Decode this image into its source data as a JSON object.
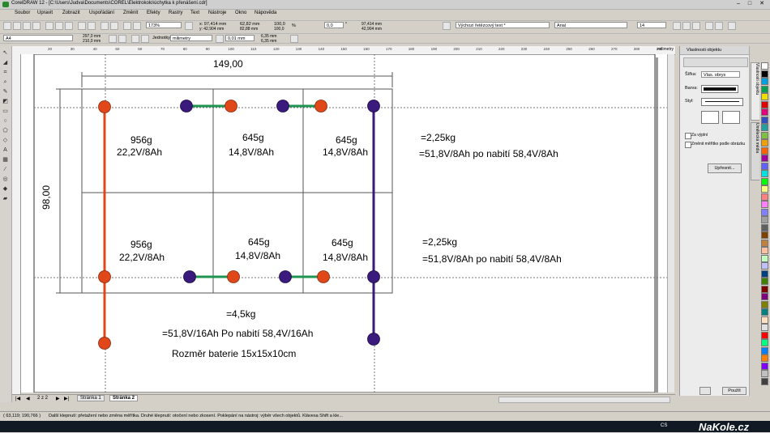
{
  "window": {
    "title": "CorelDRAW 12 - [C:\\Users\\Judva\\Documents\\COREL\\Elektrokolo\\úchytka k přenášení.cdr]"
  },
  "menu": [
    "Soubor",
    "Upravit",
    "Zobrazit",
    "Uspořádání",
    "Změnit",
    "Efekty",
    "Rastry",
    "Text",
    "Nástroje",
    "Okno",
    "Nápověda"
  ],
  "toolbar": {
    "zoom": "173%",
    "pos_x": "x: 97,414 mm",
    "pos_y": "y: 42,904 mm",
    "size_w": "62,82 mm",
    "size_h": "82,88 mm",
    "scale_w": "100,0",
    "scale_h": "100,0",
    "percent": "%",
    "angle": "0,0",
    "angle_unit": "°",
    "x2": "97,414 mm",
    "y2": "42,904 mm",
    "text_style": "Výchozí řetězcový text *",
    "font": "Arial",
    "font_size": "14"
  },
  "propbar": {
    "paper": "A4",
    "page_w": "297,0 mm",
    "page_h": "210,0 mm",
    "units_label": "Jednotky:",
    "units": "milimetry",
    "nudge": "0,01 mm",
    "dup_x": "6,35 mm",
    "dup_y": "6,35 mm"
  },
  "ruler": {
    "unit": "milimetry",
    "ticks_h": [
      "20",
      "30",
      "40",
      "50",
      "60",
      "70",
      "80",
      "90",
      "100",
      "110",
      "120",
      "130",
      "140",
      "150",
      "160",
      "170",
      "180",
      "190",
      "200",
      "210",
      "220",
      "230",
      "240",
      "250",
      "260",
      "270",
      "280",
      "290"
    ]
  },
  "drawing": {
    "width_dim": "149,00",
    "height_dim": "98,00",
    "cells": [
      {
        "mass": "956g",
        "volt": "22,2V/8Ah"
      },
      {
        "mass": "645g",
        "volt": "14,8V/8Ah"
      },
      {
        "mass": "645g",
        "volt": "14,8V/8Ah"
      },
      {
        "mass": "956g",
        "volt": "22,2V/8Ah"
      },
      {
        "mass": "645g",
        "volt": "14,8V/8Ah"
      },
      {
        "mass": "645g",
        "volt": "14,8V/8Ah"
      }
    ],
    "row1_total": "=2,25kg",
    "row1_info": "=51,8V/8Ah po nabití 58,4V/8Ah",
    "row2_total": "=2,25kg",
    "row2_info": "=51,8V/8Ah po nabití 58,4V/8Ah",
    "total_mass": "=4,5kg",
    "total_info": "=51,8V/16Ah Po nabití 58,4V/16Ah",
    "size_info": "Rozměr baterie 15x15x10cm",
    "colors": {
      "red": "#e0481a",
      "purple": "#3b1a7e",
      "green": "#1f9450",
      "grid": "#555555"
    }
  },
  "pages": {
    "counter": "2 z 2",
    "tab1": "Stránka 1",
    "tab2": "Stránka 2"
  },
  "docker": {
    "title": "Vlastnosti objektu",
    "width_label": "Šířka:",
    "width_value": "Vlas. obrys",
    "color_label": "Barva:",
    "style_label": "Styl:",
    "behind_fill": "Za výplní",
    "scale_with": "Změnit měřítko podle obrázku",
    "advanced": "Upřesnit...",
    "apply": "Použít",
    "tab1": "Vlastnosti objektu",
    "tab2": "Umělecká média"
  },
  "status": {
    "coords": "( 63,119; 190,766 )",
    "hint": "Další klepnutí: přetažení nebo změna měřítka. Druhé klepnutí: otočení  nebo zkosení. Poklepání na nástroj: výběr všech objektů. Klávesa Shift a kle..."
  },
  "taskbar": {
    "lang": "CS",
    "watermark": "NaKole.cz"
  },
  "palette": [
    "#ffffff",
    "#000000",
    "#00a0e0",
    "#00a04f",
    "#f0e000",
    "#e00000",
    "#e0007e",
    "#3050c0",
    "#20a0a0",
    "#80c040",
    "#f0a000",
    "#ff6000",
    "#a000a0",
    "#6060ff",
    "#00e0e0",
    "#00ff00",
    "#ffff80",
    "#ff8080",
    "#ff80ff",
    "#8080ff",
    "#a0a0a0",
    "#606060",
    "#804000",
    "#c08040",
    "#ffc0a0",
    "#c0ffc0",
    "#c0c0ff",
    "#004080",
    "#408000",
    "#800000",
    "#800080",
    "#808000",
    "#008080",
    "#ffe0c0",
    "#e0e0e0",
    "#ff0000",
    "#00ff80",
    "#0080ff",
    "#ff8000",
    "#8000ff",
    "#c0c0c0",
    "#404040"
  ]
}
